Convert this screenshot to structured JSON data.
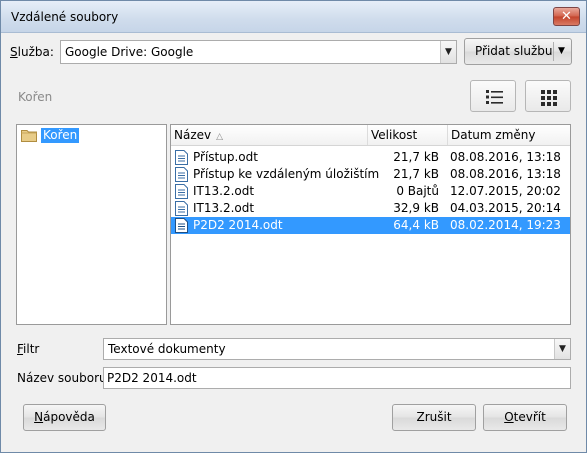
{
  "dialog": {
    "title": "Vzdálené soubory",
    "close": "✕"
  },
  "service": {
    "label": "Služba:",
    "label_accel": "S",
    "label_rest": "lužba:",
    "value": "Google Drive: Google",
    "add_button": "Přidat službu"
  },
  "breadcrumb": "Kořen",
  "view_buttons": [
    "list-view-icon",
    "grid-view-icon"
  ],
  "tree": {
    "items": [
      {
        "label": "Kořen",
        "icon": "folder-icon",
        "selected": true
      }
    ]
  },
  "file_list": {
    "columns": [
      "Název",
      "Velikost",
      "Datum změny"
    ],
    "rows": [
      {
        "name": "Přístup.odt",
        "size": "21,7 kB",
        "date": "08.08.2016, 13:18",
        "selected": false
      },
      {
        "name": "Přístup ke vzdáleným úložištím",
        "size": "21,7 kB",
        "date": "08.08.2016, 13:18",
        "selected": false
      },
      {
        "name": "IT13.2.odt",
        "size": "0 Bajtů",
        "date": "12.07.2015, 20:02",
        "selected": false
      },
      {
        "name": "IT13.2.odt",
        "size": "32,9 kB",
        "date": "04.03.2015, 20:14",
        "selected": false
      },
      {
        "name": "P2D2 2014.odt",
        "size": "64,4 kB",
        "date": "08.02.2014, 19:23",
        "selected": true
      }
    ]
  },
  "filter": {
    "label": "Filtr",
    "label_accel": "F",
    "label_rest": "iltr",
    "value": "Textové dokumenty"
  },
  "filename": {
    "label": "Název souboru",
    "value": "P2D2 2014.odt"
  },
  "buttons": {
    "help": "Nápověda",
    "help_accel": "N",
    "help_rest": "ápověda",
    "cancel": "Zrušit",
    "open": "Otevřít",
    "open_accel": "O",
    "open_rest": "tevřít"
  },
  "colors": {
    "selection": "#3399ff",
    "window_bg": "#f0f0f0"
  }
}
